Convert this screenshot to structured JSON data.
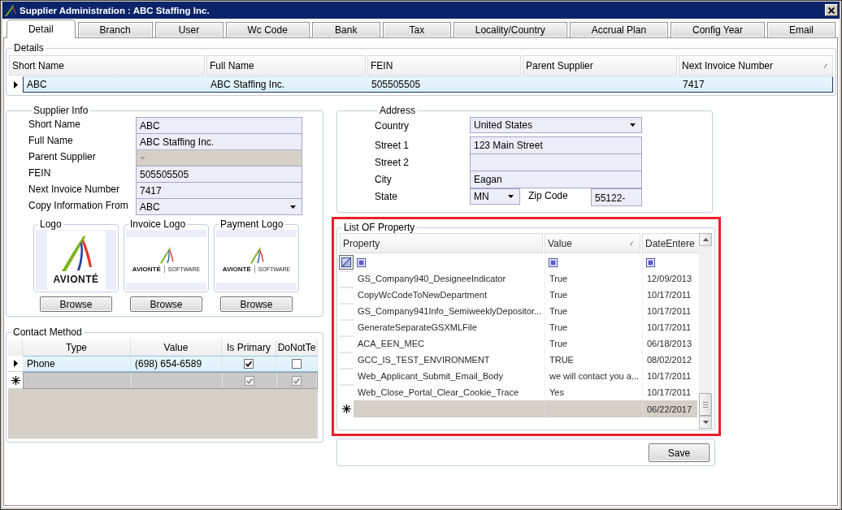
{
  "window": {
    "title": "Supplier Administration : ABC Staffing Inc."
  },
  "tabs": [
    {
      "label": "Detail",
      "selected": true
    },
    {
      "label": "Branch",
      "selected": false
    },
    {
      "label": "User",
      "selected": false
    },
    {
      "label": "Wc Code",
      "selected": false
    },
    {
      "label": "Bank",
      "selected": false
    },
    {
      "label": "Tax",
      "selected": false
    },
    {
      "label": "Locality/Country",
      "selected": false
    },
    {
      "label": "Accrual Plan",
      "selected": false
    },
    {
      "label": "Config Year",
      "selected": false
    },
    {
      "label": "Email",
      "selected": false
    }
  ],
  "details": {
    "title": "Details",
    "columns": [
      {
        "label": "Short Name",
        "sorted": false
      },
      {
        "label": "Full Name",
        "sorted": false
      },
      {
        "label": "FEIN",
        "sorted": false
      },
      {
        "label": "Parent Supplier",
        "sorted": false
      },
      {
        "label": "Next Invoice Number",
        "sorted": true
      }
    ],
    "rows": [
      {
        "selected": true,
        "cells": [
          "ABC",
          "ABC Staffing Inc.",
          "505505505",
          null,
          "7417"
        ]
      }
    ]
  },
  "supplier_info": {
    "title": "Supplier Info",
    "fields": [
      {
        "label": "Short Name",
        "kind": "text",
        "value": "ABC",
        "disabled": false
      },
      {
        "label": "Full Name",
        "kind": "text",
        "value": "ABC Staffing Inc.",
        "disabled": false
      },
      {
        "label": "Parent Supplier",
        "kind": "dropdown",
        "disabled": true
      },
      {
        "label": "FEIN",
        "kind": "text",
        "value": "505505505",
        "disabled": false
      },
      {
        "label": "Next Invoice Number",
        "kind": "text",
        "value": "7417",
        "disabled": false
      },
      {
        "label": "Copy Information From",
        "kind": "dropdown",
        "value": "ABC",
        "disabled": false
      }
    ],
    "logos": [
      {
        "title": "Logo",
        "kind": "square",
        "wordmark": "AVIONTÉ",
        "button": "Browse"
      },
      {
        "title": "Invoice Logo",
        "kind": "banner",
        "wordmark": "AVIONTÉ",
        "tagline": "SOFTWARE",
        "button": "Browse"
      },
      {
        "title": "Payment Logo",
        "kind": "banner",
        "wordmark": "AVIONTÉ",
        "tagline": "SOFTWARE",
        "button": "Browse"
      }
    ]
  },
  "contact_method": {
    "title": "Contact Method",
    "columns": [
      "Type",
      "Value",
      "Is Primary",
      "DoNotTe"
    ],
    "rows": [
      {
        "kind": "data",
        "selected": true,
        "cells": [
          "Phone",
          "(698) 654-6589"
        ],
        "checks": [
          {
            "checked": true,
            "disabled": false
          },
          {
            "checked": false,
            "disabled": false
          }
        ]
      },
      {
        "kind": "new",
        "selected": false,
        "checks": [
          {
            "checked": true,
            "disabled": true
          },
          {
            "checked": true,
            "disabled": true
          }
        ]
      }
    ]
  },
  "address": {
    "title": "Address",
    "fields": [
      {
        "label": "Country",
        "kind": "dropdown",
        "value": "United States"
      },
      {
        "label": "Street 1",
        "kind": "text",
        "value": "123 Main Street"
      },
      {
        "label": "Street 2",
        "kind": "text"
      },
      {
        "label": "City",
        "kind": "text",
        "value": "Eagan"
      }
    ],
    "state": {
      "label": "State",
      "value": "MN"
    },
    "zip": {
      "label": "Zip Code",
      "value": "55122-"
    }
  },
  "property_list": {
    "title": "List OF Property",
    "highlighted": true,
    "columns": [
      {
        "label": "Property",
        "sorted": false
      },
      {
        "label": "Value",
        "sorted": true
      },
      {
        "label": "DateEntere",
        "sorted": false
      }
    ],
    "rows": [
      {
        "kind": "data",
        "property": "GS_Company940_DesigneeIndicator",
        "value": "True",
        "date": "12/09/2013"
      },
      {
        "kind": "data",
        "property": "CopyWcCodeToNewDepartment",
        "value": "True",
        "date": "10/17/2011"
      },
      {
        "kind": "data",
        "property": "GS_Company941Info_SemiweeklyDepositor...",
        "value": "True",
        "date": "10/17/2011"
      },
      {
        "kind": "data",
        "property": "GenerateSeparateGSXMLFile",
        "value": "True",
        "date": "10/17/2011"
      },
      {
        "kind": "data",
        "property": "ACA_EEN_MEC",
        "value": "True",
        "date": "06/18/2013"
      },
      {
        "kind": "data",
        "property": "GCC_IS_TEST_ENVIRONMENT",
        "value": "TRUE",
        "date": "08/02/2012"
      },
      {
        "kind": "data",
        "property": "Web_Applicant_Submit_Email_Body",
        "value": "we will contact you a...",
        "date": "10/17/2011"
      },
      {
        "kind": "data",
        "property": "Web_Close_Portal_Clear_Cookie_Trace",
        "value": "Yes",
        "date": "10/17/2011"
      },
      {
        "kind": "new",
        "date": "06/22/2017"
      }
    ]
  },
  "save_button": "Save"
}
